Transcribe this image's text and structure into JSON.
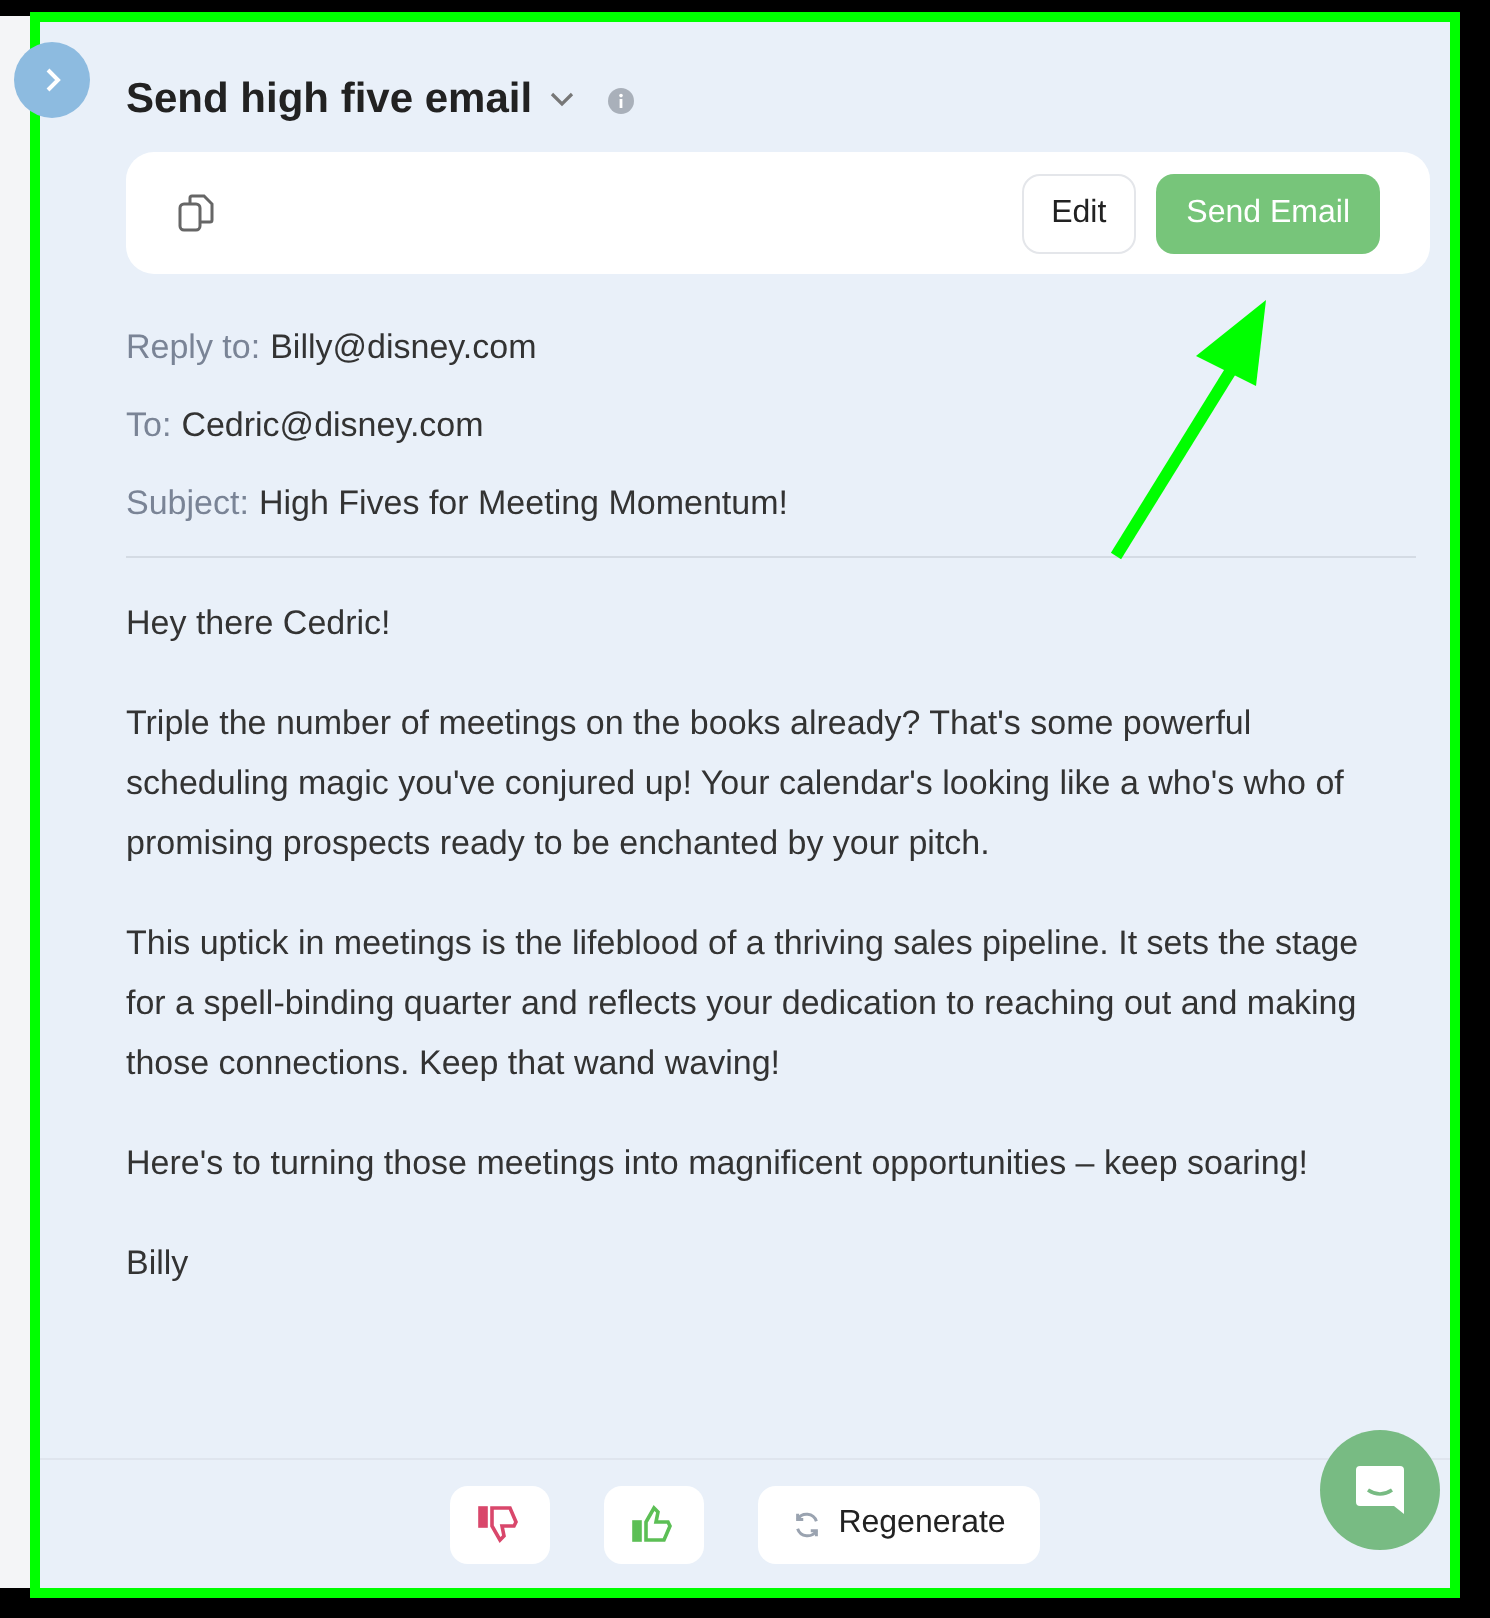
{
  "title": "Send high five email",
  "toolbar": {
    "buttons": [
      {
        "label": "Edit",
        "kind": "secondary"
      },
      {
        "label": "Send Email",
        "kind": "primary"
      }
    ]
  },
  "headers": [
    {
      "label": "Reply to:",
      "value": "Billy@disney.com"
    },
    {
      "label": "To:",
      "value": "Cedric@disney.com"
    },
    {
      "label": "Subject:",
      "value": "High Fives for Meeting Momentum!"
    }
  ],
  "body": [
    "Hey there Cedric!",
    "Triple the number of meetings on the books already? That's some powerful scheduling magic you've conjured up! Your calendar's looking like a who's who of promising prospects ready to be enchanted by your pitch.",
    "This uptick in meetings is the lifeblood of a thriving sales pipeline. It sets the stage for a spell-binding quarter and reflects your dedication to reaching out and making those connections. Keep that wand waving!",
    "Here's to turning those meetings into magnificent opportunities – keep soaring!",
    "Billy"
  ],
  "footer": {
    "regenerate": "Regenerate"
  }
}
